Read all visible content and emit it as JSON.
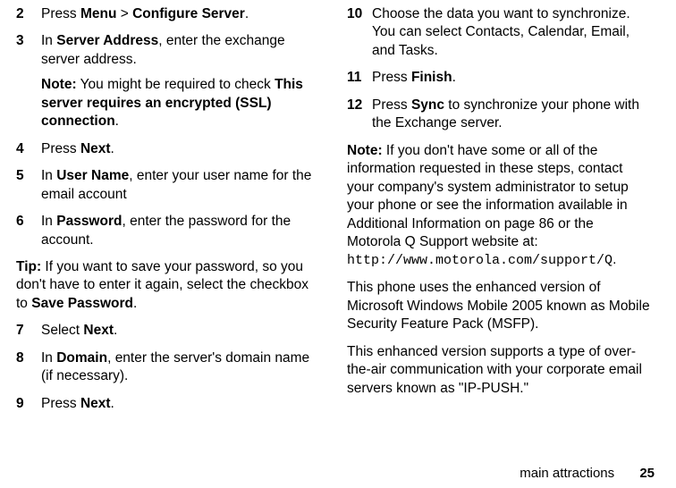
{
  "left": {
    "s2": {
      "num": "2",
      "t1": "Press ",
      "menu": "Menu",
      "gt": " > ",
      "cfg": "Configure Server",
      "t2": "."
    },
    "s3": {
      "num": "3",
      "t1": "In ",
      "sa": "Server Address",
      "t2": ", enter the exchange server address.",
      "note_label": "Note:",
      "note_body": " You might be required to check ",
      "note_bold": "This server requires an encrypted (SSL) connection",
      "note_end": "."
    },
    "s4": {
      "num": "4",
      "t1": "Press ",
      "next": "Next",
      "t2": "."
    },
    "s5": {
      "num": "5",
      "t1": "In ",
      "un": "User Name",
      "t2": ", enter your user name for the email account"
    },
    "s6": {
      "num": "6",
      "t1": "In ",
      "pw": "Password",
      "t2": ", enter the password for the account."
    },
    "tip": {
      "label": "Tip:",
      "body": " If you want to save your password, so you don't have to enter it again, select the checkbox to ",
      "sp": "Save Password",
      "end": "."
    },
    "s7": {
      "num": "7",
      "t1": "Select ",
      "next": "Next",
      "t2": "."
    },
    "s8": {
      "num": "8",
      "t1": "In ",
      "dom": "Domain",
      "t2": ", enter the server's domain name (if necessary)."
    },
    "s9": {
      "num": "9",
      "t1": "Press ",
      "next": "Next",
      "t2": "."
    }
  },
  "right": {
    "s10": {
      "num": "10",
      "t": "Choose the data you want to synchronize. You can select Contacts, Calendar, Email, and Tasks."
    },
    "s11": {
      "num": "11",
      "t1": "Press ",
      "fin": "Finish",
      "t2": "."
    },
    "s12": {
      "num": "12",
      "t1": "Press ",
      "sync": "Sync",
      "t2": " to synchronize your phone with the Exchange server."
    },
    "note": {
      "label": "Note:",
      "body": " If you don't have some or all of the information requested in these steps, contact your company's system administrator to setup your phone or see the information available in Additional Information on page 86 or the Motorola Q Support website at:"
    },
    "url": "http://www.motorola.com/support/Q",
    "urlend": ".",
    "p1": "This phone uses the enhanced version of Microsoft Windows Mobile 2005 known as Mobile Security Feature Pack (MSFP).",
    "p2": "This enhanced version supports a type of over-the-air communication with your corporate email servers known as \"IP-PUSH.\""
  },
  "footer": {
    "section": "main attractions",
    "page": "25"
  }
}
